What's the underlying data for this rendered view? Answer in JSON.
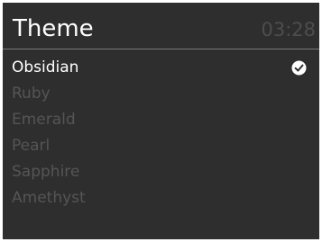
{
  "header": {
    "title": "Theme",
    "clock": "03:28"
  },
  "themes": {
    "items": [
      {
        "label": "Obsidian",
        "selected": true
      },
      {
        "label": "Ruby",
        "selected": false
      },
      {
        "label": "Emerald",
        "selected": false
      },
      {
        "label": "Pearl",
        "selected": false
      },
      {
        "label": "Sapphire",
        "selected": false
      },
      {
        "label": "Amethyst",
        "selected": false
      }
    ],
    "selected_icon": "check-circle-icon"
  },
  "colors": {
    "background": "#2e2e2e",
    "selected_text": "#ffffff",
    "unselected_text": "#555555",
    "clock_text": "#4d4d4d",
    "divider": "#7a7a7a"
  }
}
